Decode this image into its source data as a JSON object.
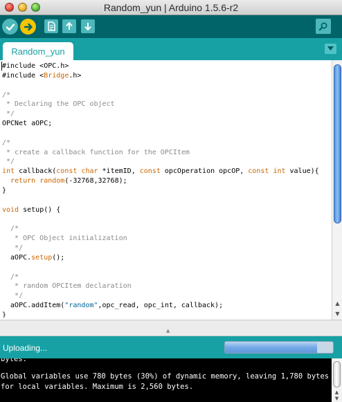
{
  "window": {
    "title": "Random_yun | Arduino 1.5.6-r2"
  },
  "toolbar": {
    "buttons": [
      {
        "name": "verify",
        "icon": "checkmark-icon"
      },
      {
        "name": "upload",
        "icon": "arrow-right-icon"
      },
      {
        "name": "new",
        "icon": "document-icon"
      },
      {
        "name": "open",
        "icon": "arrow-up-icon"
      },
      {
        "name": "save",
        "icon": "arrow-down-icon"
      },
      {
        "name": "serial-monitor",
        "icon": "magnifier-icon"
      }
    ]
  },
  "tabs": [
    {
      "label": "Random_yun",
      "active": true
    }
  ],
  "editor": {
    "lines": [
      "#include <OPC.h>",
      "#include <Bridge.h>",
      "",
      "/*",
      " * Declaring the OPC object",
      " */",
      "OPCNet aOPC;",
      "",
      "/*",
      " * create a callback function for the OPCItem",
      " */",
      "int callback(const char *itemID, const opcOperation opcOP, const int value){",
      "  return random(-32768,32768);",
      "}",
      "",
      "void setup() {",
      "",
      "  /*",
      "   * OPC Object initialization",
      "   */",
      "  aOPC.setup();",
      "",
      "  /*",
      "   * random OPCItem declaration",
      "   */",
      "  aOPC.addItem(\"random\",opc_read, opc_int, callback);",
      "}"
    ]
  },
  "status": {
    "message": "Uploading...",
    "progress_fraction": 0.85
  },
  "console": {
    "lines": [
      "Global variables use 780 bytes (30%) of dynamic memory, leaving 1,780 bytes",
      "for local variables. Maximum is 2,560 bytes."
    ],
    "partial_top_line": "bytes."
  },
  "colors": {
    "toolbar": "#006468",
    "tabbar": "#17a1a5",
    "console_bg": "#000000"
  }
}
